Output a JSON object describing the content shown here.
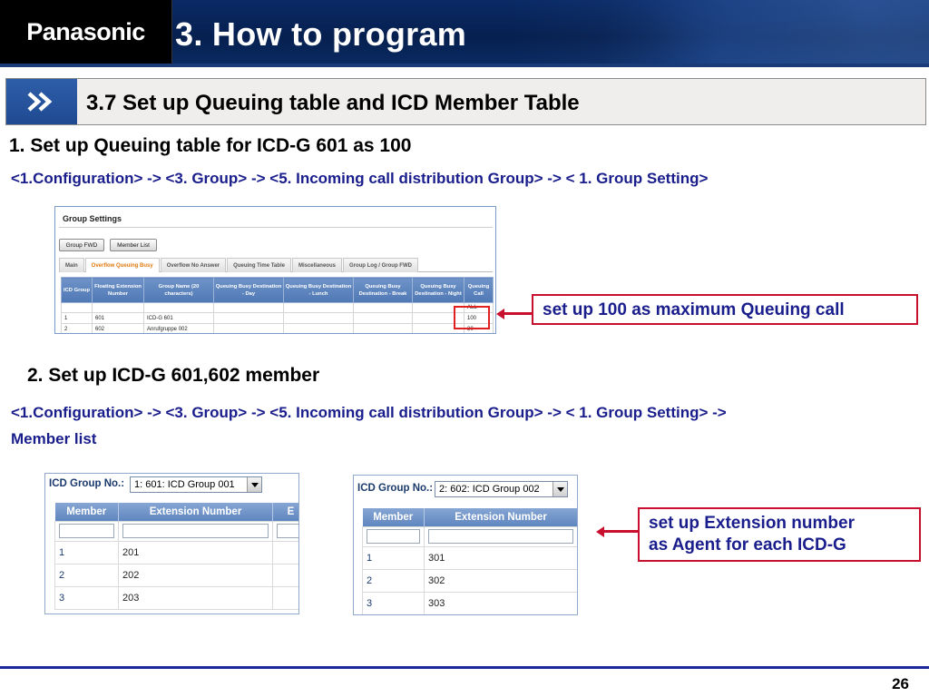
{
  "header": {
    "logo": "Panasonic",
    "title": "3. How to program"
  },
  "section": {
    "title": "3.7 Set up Queuing table and ICD Member Table"
  },
  "step1": {
    "heading": "1. Set up Queuing table for ICD-G 601 as 100",
    "path": "<1.Configuration> -> <3. Group> -> <5. Incoming call distribution Group> -> < 1. Group Setting>"
  },
  "group_settings": {
    "title": "Group Settings",
    "buttons": [
      "Group FWD",
      "Member List"
    ],
    "tabs": [
      "Main",
      "Overflow Queuing Busy",
      "Overflow No Answer",
      "Queuing Time Table",
      "Miscellaneous",
      "Group Log / Group FWD"
    ],
    "active_tab": "Overflow Queuing Busy",
    "columns": [
      "ICD Group",
      "Floating Extension Number",
      "Group Name (20 characters)",
      "Queuing Busy Destination - Day",
      "Queuing Busy Destination - Lunch",
      "Queuing Busy Destination - Break",
      "Queuing Busy Destination - Night",
      "Queuing Call"
    ],
    "filter_value": "ALL",
    "rows": [
      [
        "1",
        "601",
        "ICD-G 601",
        "",
        "",
        "",
        "",
        "100"
      ],
      [
        "2",
        "602",
        "Anrufgruppe 002",
        "",
        "",
        "",
        "",
        "30"
      ]
    ]
  },
  "callout1": "set up 100 as maximum Queuing call",
  "step2": {
    "heading": "2. Set up ICD-G 601,602 member",
    "path_line1": "<1.Configuration> -> <3. Group> -> <5. Incoming call distribution Group> -> < 1. Group Setting> ->",
    "path_line2": "Member list"
  },
  "member_panel_1": {
    "label": "ICD Group No.:",
    "selected": "1: 601: ICD Group 001",
    "columns": [
      "Member",
      "Extension Number",
      "E"
    ],
    "rows": [
      {
        "member": "1",
        "ext": "201"
      },
      {
        "member": "2",
        "ext": "202"
      },
      {
        "member": "3",
        "ext": "203"
      }
    ]
  },
  "member_panel_2": {
    "label": "ICD Group No.:",
    "selected": "2: 602: ICD Group 002",
    "columns": [
      "Member",
      "Extension Number"
    ],
    "rows": [
      {
        "member": "1",
        "ext": "301"
      },
      {
        "member": "2",
        "ext": "302"
      },
      {
        "member": "3",
        "ext": "303"
      }
    ]
  },
  "callout2": {
    "line1": "set up Extension number",
    "line2": "as Agent for each ICD-G"
  },
  "footer": {
    "page_number": "26"
  },
  "colors": {
    "banner": "#06204f",
    "accent_blue": "#1f4a92",
    "path_text": "#1a1e8c",
    "callout_border": "#c8102e"
  }
}
